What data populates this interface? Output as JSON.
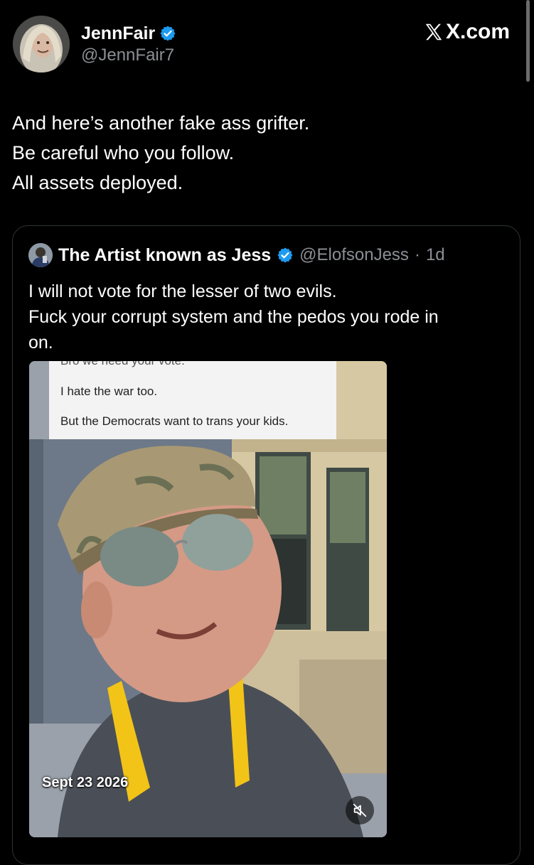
{
  "post": {
    "author": {
      "display_name": "JennFair",
      "handle": "@JennFair7",
      "verified": true
    },
    "brand": "X.com",
    "text_lines": [
      "And here’s another fake ass grifter.",
      "Be careful who you follow.",
      "All assets deployed."
    ]
  },
  "quote": {
    "author": {
      "display_name": "The Artist known as Jess",
      "handle": "@ElofsonJess",
      "separator": "·",
      "time": "1d",
      "verified": true
    },
    "text_lines": [
      "I will not vote for the lesser of two evils.",
      "Fuck your corrupt system and the pedos you rode in",
      "on."
    ],
    "media": {
      "caption_lines": [
        "Bro we need your vote.",
        "I hate the war too.",
        "But the Democrats want to trans your kids."
      ],
      "date_stamp": "Sept 23 2026",
      "mute_icon": "speaker-muted-icon"
    }
  },
  "colors": {
    "background": "#000000",
    "text": "#ffffff",
    "secondary_text": "#8b8f94",
    "verified_blue": "#1d9bf0",
    "border": "#2f3336"
  }
}
